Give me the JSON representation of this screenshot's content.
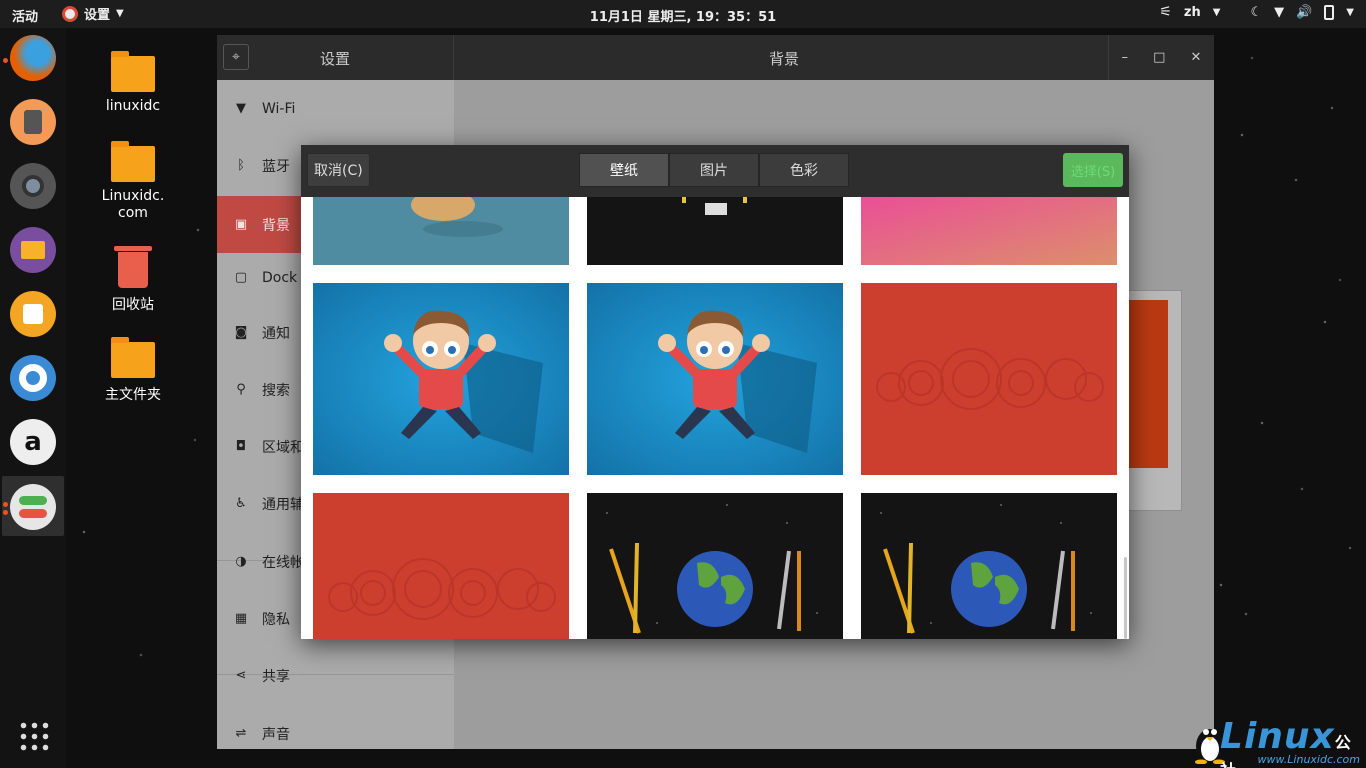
{
  "topbar": {
    "activities": "活动",
    "app_menu": "设置",
    "clock": "11月1日 星期三, 19：35：51",
    "input_method": "zh"
  },
  "dock": {
    "items": [
      "firefox-icon",
      "rhythmbox-icon",
      "camera-icon",
      "files-icon",
      "software-icon",
      "help-icon",
      "amazon-icon",
      "settings-icon"
    ]
  },
  "desktop": {
    "icons": [
      {
        "label": "linuxidc",
        "icon": "folder-icon"
      },
      {
        "label": "Linuxidc.\ncom",
        "icon": "folder-icon"
      },
      {
        "label": "回收站",
        "icon": "trash-icon"
      },
      {
        "label": "主文件夹",
        "icon": "home-folder-icon"
      }
    ]
  },
  "window": {
    "sidebar_title": "设置",
    "content_title": "背景",
    "sidebar_items": [
      {
        "label": "Wi-Fi",
        "icon": "wifi-icon"
      },
      {
        "label": "蓝牙",
        "icon": "bluetooth-icon"
      },
      {
        "label": "背景",
        "icon": "background-icon",
        "active": true
      },
      {
        "label": "Dock",
        "icon": "dock-icon"
      },
      {
        "label": "通知",
        "icon": "notification-icon"
      },
      {
        "label": "搜索",
        "icon": "search-icon"
      },
      {
        "label": "区域和",
        "icon": "region-icon"
      },
      {
        "label": "通用辅",
        "icon": "accessibility-icon"
      },
      {
        "label": "在线帐",
        "icon": "online-accounts-icon"
      },
      {
        "label": "隐私",
        "icon": "privacy-icon"
      },
      {
        "label": "共享",
        "icon": "share-icon"
      },
      {
        "label": "声音",
        "icon": "sound-icon"
      }
    ]
  },
  "dialog": {
    "cancel": "取消(C)",
    "tabs": [
      "壁纸",
      "图片",
      "色彩"
    ],
    "active_tab": "壁纸",
    "select": "选择(S)",
    "select_color": "#5cb85c",
    "wallpapers": [
      {
        "id": "teddy",
        "colors": [
          "#4f8ba1",
          "#7fa8b8"
        ]
      },
      {
        "id": "dark",
        "colors": [
          "#111111",
          "#2a2a2a"
        ]
      },
      {
        "id": "pink",
        "colors": [
          "#e95b95",
          "#d98a6a"
        ]
      },
      {
        "id": "boy-1",
        "colors": [
          "#1a7fb8",
          "#1f9bd6"
        ]
      },
      {
        "id": "boy-2",
        "colors": [
          "#1a7fb8",
          "#1f9bd6"
        ]
      },
      {
        "id": "red-circles-1",
        "colors": [
          "#c53a2b",
          "#d9493a"
        ]
      },
      {
        "id": "red-circles-2",
        "colors": [
          "#c53a2b",
          "#d9493a"
        ]
      },
      {
        "id": "earth-pencils-1",
        "colors": [
          "#111111",
          "#1e1e1e"
        ]
      },
      {
        "id": "earth-pencils-2",
        "colors": [
          "#111111",
          "#1e1e1e"
        ]
      }
    ]
  },
  "watermark": {
    "brand": "Linux",
    "brand_cn": "公社",
    "url": "www.Linuxidc.com"
  }
}
